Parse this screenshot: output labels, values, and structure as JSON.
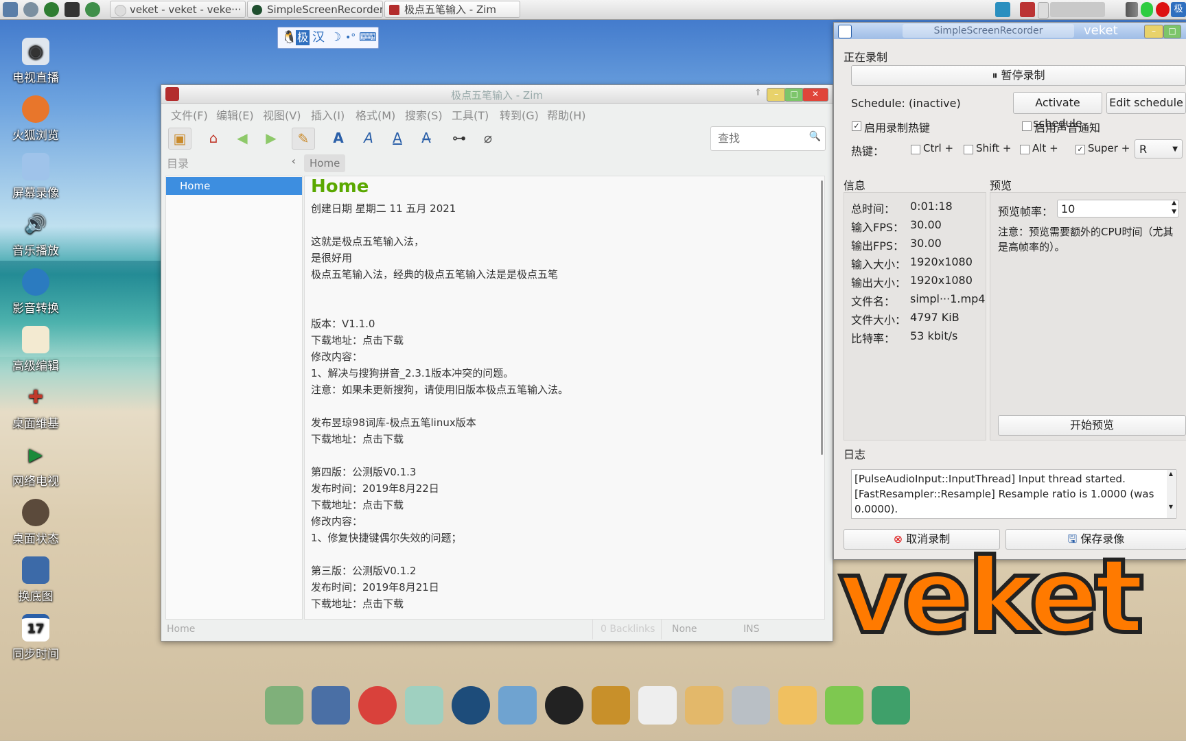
{
  "taskbar": {
    "tasks": [
      {
        "label": "veket - veket - veke···"
      },
      {
        "label": "SimpleScreenRecorder"
      },
      {
        "label": "极点五笔输入 - Zim"
      }
    ],
    "tray_label": "极"
  },
  "ime": {
    "mode": "极",
    "lang": "汉"
  },
  "desktop_icons": [
    {
      "label": "电视直播",
      "icon": "tv-icon"
    },
    {
      "label": "火狐浏览",
      "icon": "firefox-icon"
    },
    {
      "label": "屏幕录像",
      "icon": "screen-record-icon"
    },
    {
      "label": "音乐播放",
      "icon": "music-icon"
    },
    {
      "label": "影音转换",
      "icon": "video-convert-icon"
    },
    {
      "label": "高级编辑",
      "icon": "editor-icon"
    },
    {
      "label": "桌面维基",
      "icon": "wiki-icon"
    },
    {
      "label": "网络电视",
      "icon": "play-icon"
    },
    {
      "label": "桌面状态",
      "icon": "status-icon"
    },
    {
      "label": "换底图",
      "icon": "wallpaper-icon"
    },
    {
      "label": "同步时间",
      "icon": "calendar-icon"
    }
  ],
  "zim": {
    "title": "极点五笔输入 - Zim",
    "menu": [
      "文件(F)",
      "编辑(E)",
      "视图(V)",
      "插入(I)",
      "格式(M)",
      "搜索(S)",
      "工具(T)",
      "转到(G)",
      "帮助(H)"
    ],
    "search_placeholder": "查找",
    "index_label": "目录",
    "breadcrumb": "Home",
    "tree_selected": "Home",
    "page_title": "Home",
    "lines": [
      "创建日期 星期二 11 五月 2021",
      "",
      "这就是极点五笔输入法，",
      "是很好用",
      "极点五笔输入法，经典的极点五笔输入法是是极点五笔",
      "",
      "",
      "版本：V1.1.0",
      "下载地址：点击下载",
      "修改内容：",
      "1、解决与搜狗拼音_2.3.1版本冲突的问题。",
      "注意：如果未更新搜狗，请使用旧版本极点五笔输入法。",
      "",
      "发布昱琼98词库-极点五笔linux版本",
      "下载地址：点击下载",
      "",
      "第四版：公测版V0.1.3",
      "发布时间：2019年8月22日",
      "下载地址：点击下载",
      "修改内容：",
      "1、修复快捷键偶尔失效的问题；",
      "",
      "第三版：公测版V0.1.2",
      "发布时间：2019年8月21日",
      "下载地址：点击下载"
    ],
    "status": {
      "page": "Home",
      "backlinks": "0 Backlinks",
      "style": "None",
      "mode": "INS"
    }
  },
  "ssr": {
    "title": "SimpleScreenRecorder",
    "title_right": "veket",
    "recording_header": "正在录制",
    "pause_button": "暂停录制",
    "schedule_status": "Schedule: (inactive)",
    "activate_schedule": "Activate schedule",
    "edit_schedule": "Edit schedule",
    "enable_hotkey": "启用录制热键",
    "enable_sound": "启用声音通知",
    "hotkey_label": "热键：",
    "hotkeys": [
      {
        "label": "Ctrl +",
        "checked": false
      },
      {
        "label": "Shift +",
        "checked": false
      },
      {
        "label": "Alt +",
        "checked": false
      },
      {
        "label": "Super +",
        "checked": true
      }
    ],
    "hotkey_key": "R",
    "info_header": "信息",
    "preview_header": "预览",
    "info": [
      {
        "k": "总时间：",
        "v": "0:01:18"
      },
      {
        "k": "输入FPS：",
        "v": "30.00"
      },
      {
        "k": "输出FPS：",
        "v": "30.00"
      },
      {
        "k": "输入大小：",
        "v": "1920x1080"
      },
      {
        "k": "输出大小：",
        "v": "1920x1080"
      },
      {
        "k": "文件名：",
        "v": "simpl···1.mp4"
      },
      {
        "k": "文件大小：",
        "v": "4797 KiB"
      },
      {
        "k": "比特率：",
        "v": "53 kbit/s"
      }
    ],
    "preview_fps_label": "预览帧率：",
    "preview_fps_value": "10",
    "preview_note_1": "注意：预览需要额外的CPU时间（尤其",
    "preview_note_2": "是高帧率的）。",
    "start_preview": "开始预览",
    "log_header": "日志",
    "log_lines": [
      "[PulseAudioInput::InputThread] Input thread started.",
      "[FastResampler::Resample] Resample ratio is 1.0000 (was",
      "0.0000)."
    ],
    "cancel_button": "取消录制",
    "save_button": "保存录像"
  },
  "wallpaper_logo": "veket",
  "colors": {
    "selection": "#3d8ee0",
    "zim_title_green": "#5aa800",
    "close_red": "#e0453a"
  }
}
